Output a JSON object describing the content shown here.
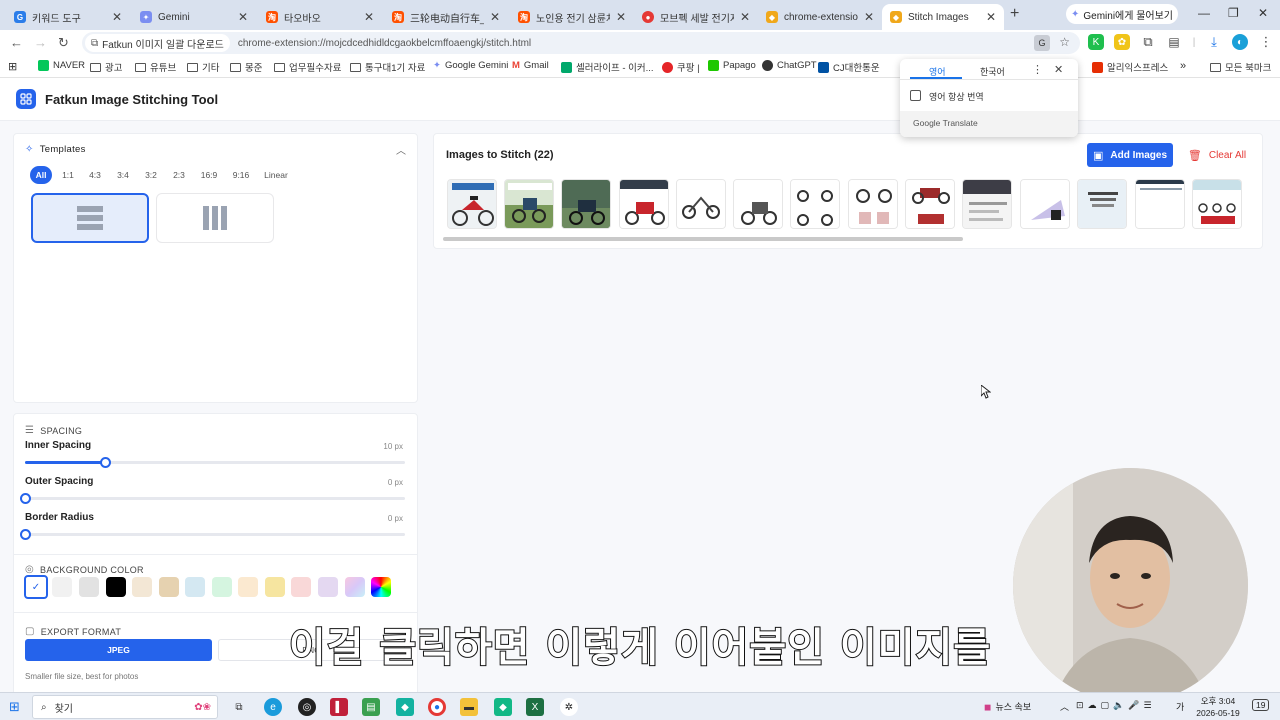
{
  "browser": {
    "tabs": [
      {
        "label": "키워드 도구",
        "color": "#2b7de9",
        "glyph": "G"
      },
      {
        "label": "Gemini",
        "color": "#7b8ef1",
        "glyph": "✦"
      },
      {
        "label": "타오바오",
        "color": "#ff5000",
        "glyph": "淘"
      },
      {
        "label": "三轮电动自行车_电动",
        "color": "#ff5000",
        "glyph": "淘"
      },
      {
        "label": "노인용 전기 삼륜차,",
        "color": "#ff5000",
        "glyph": "淘"
      },
      {
        "label": "모브펙 세발 전기자전",
        "color": "#e53935",
        "glyph": "●"
      },
      {
        "label": "chrome-extension://m",
        "color": "#f0a81b",
        "glyph": "◆"
      },
      {
        "label": "Stitch Images",
        "color": "#f0a81b",
        "glyph": "◆"
      }
    ],
    "ask_gemini": "Gemini에게 물어보기",
    "extension_chip": "Fatkun 이미지 일괄 다운로드",
    "url": "chrome-extension://mojcdcedhidldcgaokbelcmffoaengkj/stitch.html",
    "bookmarks": [
      {
        "label": "NAVER",
        "kind": "icon",
        "color": "#03c75a"
      },
      {
        "label": "광고",
        "kind": "folder"
      },
      {
        "label": "유튜브",
        "kind": "folder"
      },
      {
        "label": "기타",
        "kind": "folder"
      },
      {
        "label": "몽준",
        "kind": "folder"
      },
      {
        "label": "업무필수자료",
        "kind": "folder"
      },
      {
        "label": "통구대1기 자료",
        "kind": "folder"
      },
      {
        "label": "Google Gemini",
        "kind": "icon",
        "color": "#7b8ef1"
      },
      {
        "label": "Gmail",
        "kind": "icon",
        "color": "#ea4335"
      },
      {
        "label": "셀러라이프 - 이커...",
        "kind": "icon",
        "color": "#00a86b"
      },
      {
        "label": "쿠팡 |",
        "kind": "icon",
        "color": "#e52528"
      },
      {
        "label": "Papago",
        "kind": "icon",
        "color": "#1ec800"
      },
      {
        "label": "ChatGPT",
        "kind": "icon",
        "color": "#333333"
      },
      {
        "label": "CJ대한통운",
        "kind": "icon",
        "color": "#0052a4"
      },
      {
        "label": "알리익스프레스",
        "kind": "icon",
        "color": "#e62e04"
      },
      {
        "label": "»",
        "kind": "plain"
      },
      {
        "label": "모든 북마크",
        "kind": "folder"
      }
    ]
  },
  "translate_popup": {
    "tab_source": "영어",
    "tab_target": "한국어",
    "checkbox_label": "영어 항상 번역",
    "footer": "Google Translate"
  },
  "app": {
    "title": "Fatkun Image Stitching Tool",
    "templates": {
      "title": "Templates",
      "ratios": [
        "All",
        "1:1",
        "4:3",
        "3:4",
        "3:2",
        "2:3",
        "16:9",
        "9:16",
        "Linear"
      ],
      "active_ratio": "All"
    },
    "spacing": {
      "title": "SPACING",
      "sliders": [
        {
          "label": "Inner Spacing",
          "value": "10 px",
          "fraction": 0.21
        },
        {
          "label": "Outer Spacing",
          "value": "0 px",
          "fraction": 0
        },
        {
          "label": "Border Radius",
          "value": "0 px",
          "fraction": 0
        }
      ]
    },
    "background": {
      "title": "BACKGROUND COLOR",
      "swatches": [
        "#ffffff",
        "#f1f1f1",
        "#e2e2e2",
        "#000000",
        "#f3e7d5",
        "#e6d2b0",
        "#d4e8f2",
        "#d5f5e0",
        "#fbe9d0",
        "#f6e5a0",
        "#f9d8d8",
        "#e4d8f1",
        "gradient",
        "rainbow"
      ],
      "selected": 0
    },
    "export": {
      "title": "EXPORT FORMAT",
      "options": [
        "JPEG",
        "PNG"
      ],
      "active": "JPEG",
      "hint": "Smaller file size, best for photos"
    },
    "images": {
      "title": "Images to Stitch (22)",
      "add_label": "Add Images",
      "clear_label": "Clear All"
    }
  },
  "subtitle": "이걸 클릭하면 이렇게 이어붙인 이미지를",
  "taskbar": {
    "search_label": "찾기",
    "news": "뉴스 속보",
    "lang": "가",
    "time": "오후 3:04",
    "date": "2026-05-19",
    "notification_count": "19"
  }
}
